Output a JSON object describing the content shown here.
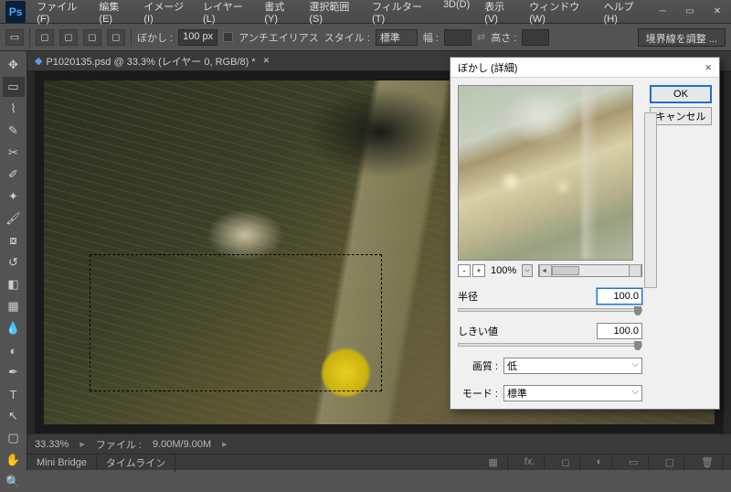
{
  "app": {
    "logo": "Ps"
  },
  "menu": {
    "file": "ファイル(F)",
    "edit": "編集(E)",
    "image": "イメージ(I)",
    "layer": "レイヤー(L)",
    "type": "書式(Y)",
    "select": "選択範囲(S)",
    "filter": "フィルター(T)",
    "three_d": "3D(D)",
    "view": "表示(V)",
    "window": "ウィンドウ(W)",
    "help": "ヘルプ(H)"
  },
  "options": {
    "feather_label": "ぼかし :",
    "feather_value": "100 px",
    "antialias": "アンチエイリアス",
    "style_label": "スタイル :",
    "style_value": "標準",
    "width_label": "幅 :",
    "height_label": "高さ :",
    "refine": "境界線を調整 ..."
  },
  "document": {
    "tab": "P1020135.psd @ 33.3% (レイヤー 0, RGB/8) *"
  },
  "status": {
    "zoom": "33.33%",
    "file_label": "ファイル :",
    "file_value": "9.00M/9.00M"
  },
  "bottom": {
    "mini_bridge": "Mini Bridge",
    "timeline": "タイムライン"
  },
  "dialog": {
    "title": "ぼかし (詳細)",
    "ok": "OK",
    "cancel": "キャンセル",
    "zoom_pct": "100%",
    "radius_label": "半径",
    "radius_value": "100.0",
    "threshold_label": "しきい値",
    "threshold_value": "100.0",
    "quality_label": "画質 :",
    "quality_value": "低",
    "mode_label": "モード :",
    "mode_value": "標準"
  }
}
